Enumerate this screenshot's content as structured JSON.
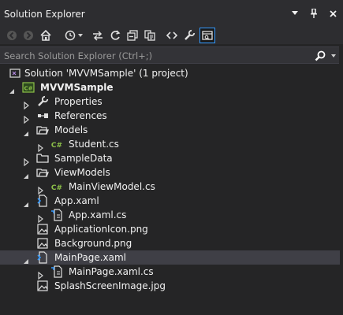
{
  "panel": {
    "title": "Solution Explorer",
    "title_buttons": [
      "chevron-down-icon",
      "pin-icon",
      "close-icon"
    ]
  },
  "toolbar": {
    "buttons": [
      {
        "name": "back-icon"
      },
      {
        "name": "forward-icon"
      },
      {
        "name": "home-icon"
      },
      {
        "name": "history-icon"
      },
      {
        "name": "sync-icon"
      },
      {
        "name": "refresh-icon"
      },
      {
        "name": "collapse-all-icon"
      },
      {
        "name": "show-all-files-icon"
      },
      {
        "name": "view-code-icon"
      },
      {
        "name": "properties-icon"
      },
      {
        "name": "preview-selected-items-icon"
      }
    ]
  },
  "search": {
    "placeholder": "Search Solution Explorer (Ctrl+;)"
  },
  "tree": [
    {
      "label": "Solution 'MVVMSample' (1 project)",
      "icon": "solution-icon",
      "expanded": null,
      "bold": false
    },
    {
      "label": "MVVMSample",
      "icon": "csharp-project-icon",
      "expanded": true,
      "bold": true
    },
    {
      "label": "Properties",
      "icon": "wrench-icon",
      "expanded": false,
      "bold": false
    },
    {
      "label": "References",
      "icon": "references-icon",
      "expanded": false,
      "bold": false
    },
    {
      "label": "Models",
      "icon": "folder-open-icon",
      "expanded": true,
      "bold": false
    },
    {
      "label": "Student.cs",
      "icon": "csharp-file-icon",
      "expanded": false,
      "bold": false
    },
    {
      "label": "SampleData",
      "icon": "folder-icon",
      "expanded": false,
      "bold": false
    },
    {
      "label": "ViewModels",
      "icon": "folder-open-icon",
      "expanded": true,
      "bold": false
    },
    {
      "label": "MainViewModel.cs",
      "icon": "csharp-file-icon",
      "expanded": false,
      "bold": false
    },
    {
      "label": "App.xaml",
      "icon": "xaml-file-icon",
      "expanded": true,
      "bold": false
    },
    {
      "label": "App.xaml.cs",
      "icon": "xaml-cs-file-icon",
      "expanded": false,
      "bold": false
    },
    {
      "label": "ApplicationIcon.png",
      "icon": "image-file-icon",
      "expanded": null,
      "bold": false
    },
    {
      "label": "Background.png",
      "icon": "image-file-icon",
      "expanded": null,
      "bold": false
    },
    {
      "label": "MainPage.xaml",
      "icon": "xaml-file-icon",
      "expanded": true,
      "bold": false,
      "selected": true
    },
    {
      "label": "MainPage.xaml.cs",
      "icon": "xaml-cs-file-icon",
      "expanded": false,
      "bold": false
    },
    {
      "label": "SplashScreenImage.jpg",
      "icon": "image-file-icon",
      "expanded": null,
      "bold": false
    }
  ],
  "colors": {
    "background": "#252526",
    "header": "#2d2d30",
    "selection": "#3f3f46",
    "accent": "#3399ff",
    "csharp_green": "#8dc149"
  }
}
